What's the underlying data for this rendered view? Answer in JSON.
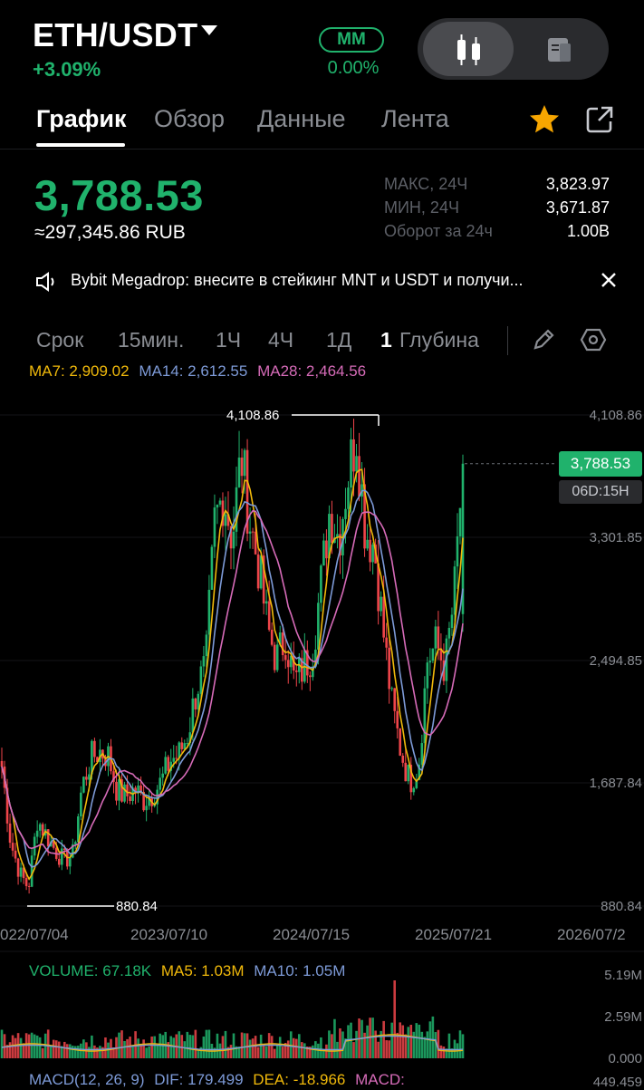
{
  "header": {
    "pair": "ETH/USDT",
    "change": "+3.09%",
    "mm_label": "MM",
    "mm_value": "0.00%"
  },
  "tabs": [
    {
      "label": "График",
      "active": true
    },
    {
      "label": "Обзор",
      "active": false
    },
    {
      "label": "Данные",
      "active": false
    },
    {
      "label": "Лента",
      "active": false
    }
  ],
  "price": {
    "last": "3,788.53",
    "rub": "≈297,345.86 RUB",
    "stats": [
      {
        "label": "МАКС, 24Ч",
        "value": "3,823.97"
      },
      {
        "label": "МИН, 24Ч",
        "value": "3,671.87"
      },
      {
        "label": "Оборот за 24ч",
        "value": "1.00B"
      }
    ]
  },
  "announcement": "Bybit Megadrop: внесите в стейкинг MNT и USDT и получи...",
  "toolbar": {
    "term": "Срок",
    "intervals": [
      "15мин.",
      "1Ч",
      "4Ч",
      "1Д"
    ],
    "selected_prefix": "1",
    "depth": "Глубина"
  },
  "indicators": {
    "ma7": "MA7: 2,909.02",
    "ma14": "MA14: 2,612.55",
    "ma28": "MA28: 2,464.56",
    "volume": "VOLUME: 67.18K",
    "vol_ma5": "MA5: 1.03M",
    "vol_ma10": "MA10: 1.05M",
    "macd_params": "MACD(12, 26, 9)",
    "dif": "DIF: 179.499",
    "dea": "DEA: -18.966",
    "macd": "MACD:"
  },
  "chart": {
    "high_marker": "4,108.86",
    "low_marker": "880.84",
    "last_price_tag": "3,788.53",
    "countdown_tag": "06D:15H",
    "y_ticks": [
      "4,108.86",
      "3,301.85",
      "2,494.85",
      "1,687.84",
      "880.84"
    ],
    "x_ticks": [
      "022/07/04",
      "2023/07/10",
      "2024/07/15",
      "2025/07/21",
      "2026/07/2"
    ],
    "vol_ticks": [
      "5.19M",
      "2.59M",
      "0.000"
    ],
    "macd_tick": "449.459",
    "colors": {
      "up": "#20b26c",
      "down": "#ef454a",
      "ma7": "#f0b90b",
      "ma14": "#7d9ad7",
      "ma28": "#d66bb8"
    }
  },
  "chart_data": {
    "type": "candlestick",
    "ylim": [
      880.84,
      4108.86
    ],
    "x_ticks": [
      "022/07/04",
      "2023/07/10",
      "2024/07/15",
      "2025/07/21",
      "2026/07/2"
    ],
    "close_series_weekly_approx": [
      1800,
      1300,
      1100,
      1000,
      1450,
      1350,
      1250,
      1180,
      1220,
      1650,
      1850,
      1900,
      1870,
      1640,
      1600,
      1650,
      1580,
      1620,
      1700,
      1840,
      1880,
      2020,
      2320,
      2450,
      3400,
      3600,
      3300,
      3850,
      3400,
      3100,
      2700,
      2500,
      2650,
      2350,
      2450,
      2550,
      3000,
      3500,
      3300,
      3700,
      4000,
      3350,
      3250,
      2700,
      2200,
      1900,
      1700,
      1800,
      2500,
      2600,
      2450,
      2900,
      3788.53
    ],
    "series": [
      {
        "name": "MA7",
        "last": 2909.02
      },
      {
        "name": "MA14",
        "last": 2612.55
      },
      {
        "name": "MA28",
        "last": 2464.56
      }
    ]
  }
}
